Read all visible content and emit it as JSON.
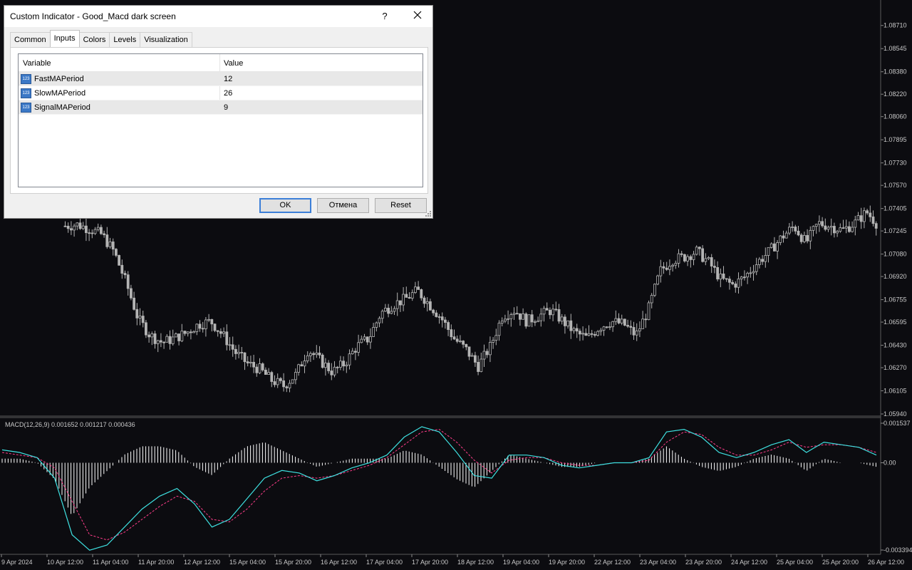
{
  "dialog": {
    "title": "Custom Indicator - Good_Macd dark screen",
    "help_label": "?",
    "tabs": [
      "Common",
      "Inputs",
      "Colors",
      "Levels",
      "Visualization"
    ],
    "active_tab": "Inputs",
    "table": {
      "col_variable": "Variable",
      "col_value": "Value",
      "type_icon": "123",
      "rows": [
        {
          "variable": "FastMAPeriod",
          "value": "12"
        },
        {
          "variable": "SlowMAPeriod",
          "value": "26"
        },
        {
          "variable": "SignalMAPeriod",
          "value": "9"
        }
      ]
    },
    "buttons": {
      "ok": "OK",
      "cancel": "Отмена",
      "reset": "Reset"
    }
  },
  "indicator": {
    "label": "MACD(12,26,9) 0.001652 0.001217 0.000436"
  },
  "colors": {
    "background": "#0c0c10",
    "candle": "#b4b4b4",
    "macd_main": "#3ee0e0",
    "macd_signal": "#ff3d8a",
    "histogram": "#ffffff"
  },
  "chart_data": [
    {
      "type": "candlestick",
      "y_ticks": [
        "1.08710",
        "1.08545",
        "1.08380",
        "1.08220",
        "1.08060",
        "1.07895",
        "1.07730",
        "1.07570",
        "1.07405",
        "1.07245",
        "1.07080",
        "1.06920",
        "1.06755",
        "1.06595",
        "1.06430",
        "1.06270",
        "1.06105",
        "1.05940"
      ],
      "ylim": [
        1.0594,
        1.0879
      ],
      "x_ticks": [
        "9 Apr 2024",
        "10 Apr 12:00",
        "11 Apr 04:00",
        "11 Apr 20:00",
        "12 Apr 12:00",
        "15 Apr 04:00",
        "15 Apr 20:00",
        "16 Apr 12:00",
        "17 Apr 04:00",
        "17 Apr 20:00",
        "18 Apr 12:00",
        "19 Apr 04:00",
        "19 Apr 20:00",
        "22 Apr 12:00",
        "23 Apr 04:00",
        "23 Apr 20:00",
        "24 Apr 12:00",
        "25 Apr 04:00",
        "25 Apr 20:00",
        "26 Apr 12:00"
      ],
      "close_path": [
        1.0728,
        1.0729,
        1.0726,
        1.0722,
        1.071,
        1.0688,
        1.0662,
        1.065,
        1.0645,
        1.0648,
        1.0652,
        1.0658,
        1.066,
        1.065,
        1.0638,
        1.063,
        1.0626,
        1.0618,
        1.0614,
        1.0622,
        1.064,
        1.0632,
        1.0624,
        1.063,
        1.0642,
        1.0648,
        1.0666,
        1.0672,
        1.0676,
        1.0682,
        1.0672,
        1.0662,
        1.0648,
        1.064,
        1.0628,
        1.0642,
        1.0664,
        1.0668,
        1.066,
        1.0664,
        1.0668,
        1.066,
        1.0652,
        1.0648,
        1.0656,
        1.066,
        1.0658,
        1.065,
        1.0668,
        1.0696,
        1.0704,
        1.0706,
        1.071,
        1.0702,
        1.069,
        1.0686,
        1.0692,
        1.0702,
        1.071,
        1.072,
        1.0728,
        1.0716,
        1.073,
        1.0728,
        1.0725,
        1.073,
        1.0738,
        1.0728
      ]
    },
    {
      "type": "macd",
      "title": "MACD(12,26,9) 0.001652 0.001217 0.000436",
      "y_ticks": [
        "0.001537",
        "0.00",
        "-0.003394"
      ],
      "ylim": [
        -0.003394,
        0.001537
      ],
      "main": [
        0.0005,
        0.0004,
        0.0002,
        -0.0006,
        -0.0028,
        -0.0034,
        -0.0032,
        -0.0025,
        -0.0018,
        -0.0013,
        -0.001,
        -0.0016,
        -0.0025,
        -0.0022,
        -0.0014,
        -0.0006,
        -0.0003,
        -0.0004,
        -0.0007,
        -0.0005,
        -0.0002,
        0.0,
        0.0003,
        0.001,
        0.0014,
        0.0012,
        0.0004,
        -0.0005,
        -0.0006,
        0.0003,
        0.0003,
        0.0002,
        -0.0001,
        -0.0002,
        -0.0001,
        0.0,
        0.0,
        0.0002,
        0.0012,
        0.0013,
        0.001,
        0.0004,
        0.0002,
        0.0004,
        0.0007,
        0.0009,
        0.0004,
        0.0008,
        0.0007,
        0.0006,
        0.0003
      ],
      "signal": [
        0.0004,
        0.0003,
        0.0002,
        -0.0002,
        -0.0015,
        -0.0028,
        -0.003,
        -0.0027,
        -0.0022,
        -0.0017,
        -0.0013,
        -0.0015,
        -0.0022,
        -0.0023,
        -0.0018,
        -0.0011,
        -0.0006,
        -0.0005,
        -0.0006,
        -0.0005,
        -0.0003,
        -0.0001,
        0.0002,
        0.0007,
        0.0012,
        0.0013,
        0.0008,
        0.0001,
        -0.0004,
        0.0001,
        0.0002,
        0.0002,
        0.0,
        -0.0001,
        -0.0001,
        0.0,
        0.0,
        0.0001,
        0.0008,
        0.0012,
        0.0011,
        0.0006,
        0.0003,
        0.0003,
        0.0005,
        0.0008,
        0.0006,
        0.0007,
        0.0007,
        0.0006,
        0.0004
      ]
    }
  ]
}
